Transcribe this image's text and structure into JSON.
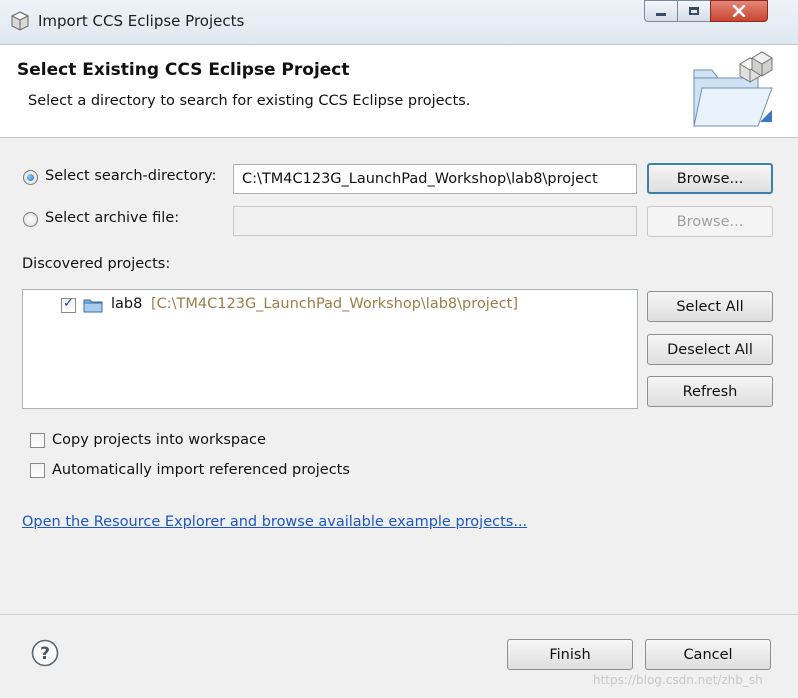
{
  "window": {
    "title": "Import CCS Eclipse Projects"
  },
  "banner": {
    "title": "Select Existing CCS Eclipse Project",
    "description": "Select a directory to search for existing CCS Eclipse projects."
  },
  "source": {
    "search_dir_label": "Select search-directory:",
    "search_dir_value": "C:\\TM4C123G_LaunchPad_Workshop\\lab8\\project",
    "search_browse": "Browse...",
    "archive_label": "Select archive file:",
    "archive_value": "",
    "archive_browse": "Browse...",
    "selected": "search-directory"
  },
  "discovered": {
    "label": "Discovered projects:",
    "projects": [
      {
        "name": "lab8",
        "path": "[C:\\TM4C123G_LaunchPad_Workshop\\lab8\\project]",
        "checked": true
      }
    ],
    "select_all": "Select All",
    "deselect_all": "Deselect All",
    "refresh": "Refresh"
  },
  "options": {
    "copy_into_workspace": "Copy projects into workspace",
    "auto_import_referenced": "Automatically import referenced projects"
  },
  "resource_link": "Open the Resource Explorer and browse available example projects...",
  "footer": {
    "finish": "Finish",
    "cancel": "Cancel"
  },
  "watermark": "https://blog.csdn.net/zhb_sh",
  "colors": {
    "link": "#1d56c6",
    "project_path": "#9c7d4a",
    "default_button_border": "#3c7fb1"
  }
}
